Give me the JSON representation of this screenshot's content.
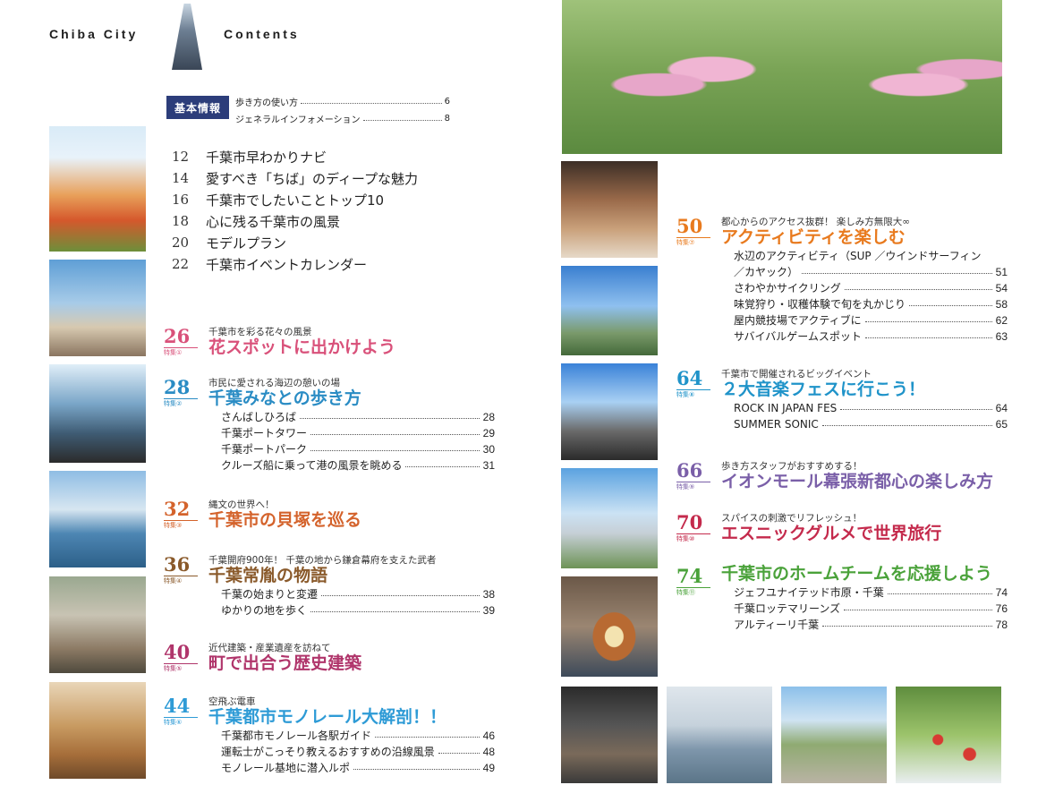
{
  "header": {
    "left": "Chiba City",
    "right": "Contents"
  },
  "basic_info": {
    "tag": "基本情報",
    "rows": [
      {
        "label": "歩き方の使い方",
        "page": "6"
      },
      {
        "label": "ジェネラルインフォメーション",
        "page": "8"
      }
    ]
  },
  "quick_nav": [
    {
      "num": "12",
      "label": "千葉市早わかりナビ"
    },
    {
      "num": "14",
      "label": "愛すべき「ちば」のディープな魅力"
    },
    {
      "num": "16",
      "label": "千葉市でしたいことトップ10"
    },
    {
      "num": "18",
      "label": "心に残る千葉市の風景"
    },
    {
      "num": "20",
      "label": "モデルプラン"
    },
    {
      "num": "22",
      "label": "千葉市イベントカレンダー"
    }
  ],
  "feature_tag": "特集",
  "sections": [
    {
      "num": "26",
      "tok": "特集①",
      "lead": "千葉市を彩る花々の風景",
      "title": "花スポットに出かけよう",
      "color": "#d9517a",
      "items": []
    },
    {
      "num": "28",
      "tok": "特集②",
      "lead": "市民に愛される海辺の憩いの場",
      "title": "千葉みなとの歩き方",
      "color": "#2a8cc4",
      "items": [
        {
          "label": "さんばしひろば",
          "page": "28"
        },
        {
          "label": "千葉ポートタワー",
          "page": "29"
        },
        {
          "label": "千葉ポートパーク",
          "page": "30"
        },
        {
          "label": "クルーズ船に乗って港の風景を眺める",
          "page": "31"
        }
      ]
    },
    {
      "num": "32",
      "tok": "特集③",
      "lead": "縄文の世界へ！",
      "title": "千葉市の貝塚を巡る",
      "color": "#d4632c",
      "items": []
    },
    {
      "num": "36",
      "tok": "特集④",
      "lead": "千葉開府900年！ 千葉の地から鎌倉幕府を支えた武者",
      "title": "千葉常胤の物語",
      "color": "#8a5a2b",
      "items": [
        {
          "label": "千葉の始まりと変遷",
          "page": "38"
        },
        {
          "label": "ゆかりの地を歩く",
          "page": "39"
        }
      ]
    },
    {
      "num": "40",
      "tok": "特集⑤",
      "lead": "近代建築・産業遺産を訪ねて",
      "title": "町で出合う歴史建築",
      "color": "#b0356b",
      "items": []
    },
    {
      "num": "44",
      "tok": "特集⑥",
      "lead": "空飛ぶ電車",
      "title": "千葉都市モノレール大解剖！！",
      "color": "#2e9bd6",
      "items": [
        {
          "label": "千葉都市モノレール各駅ガイド",
          "page": "46"
        },
        {
          "label": "運転士がこっそり教えるおすすめの沿線風景",
          "page": "48"
        },
        {
          "label": "モノレール基地に潜入ルポ",
          "page": "49"
        }
      ]
    },
    {
      "num": "50",
      "tok": "特集⑦",
      "lead": "都心からのアクセス抜群！ 楽しみ方無限大∞",
      "title": "アクティビティを楽しむ",
      "color": "#e87a1e",
      "items": [
        {
          "label": "水辺のアクティビティ（SUP ／ウインドサーフィン",
          "page": ""
        },
        {
          "label": "／カヤック）",
          "page": "51"
        },
        {
          "label": "さわやかサイクリング",
          "page": "54"
        },
        {
          "label": "味覚狩り・収穫体験で旬を丸かじり",
          "page": "58"
        },
        {
          "label": "屋内競技場でアクティブに",
          "page": "62"
        },
        {
          "label": "サバイバルゲームスポット",
          "page": "63"
        }
      ]
    },
    {
      "num": "64",
      "tok": "特集⑧",
      "lead": "千葉市で開催されるビッグイベント",
      "title": "２大音楽フェスに行こう！",
      "color": "#1f93c9",
      "items": [
        {
          "label": "ROCK IN JAPAN FES",
          "page": "64"
        },
        {
          "label": "SUMMER SONIC",
          "page": "65"
        }
      ]
    },
    {
      "num": "66",
      "tok": "特集⑨",
      "lead": "歩き方スタッフがおすすめする！",
      "title": "イオンモール幕張新都心の楽しみ方",
      "color": "#7a5fa8",
      "items": []
    },
    {
      "num": "70",
      "tok": "特集⑩",
      "lead": "スパイスの刺激でリフレッシュ！",
      "title": "エスニックグルメで世界旅行",
      "color": "#c42a4c",
      "items": []
    },
    {
      "num": "74",
      "tok": "特集⑪",
      "lead": "",
      "title": "千葉市のホームチームを応援しよう",
      "color": "#4aa23a",
      "items": [
        {
          "label": "ジェフユナイテッド市原・千葉",
          "page": "74"
        },
        {
          "label": "千葉ロッテマリーンズ",
          "page": "76"
        },
        {
          "label": "アルティーリ千葉",
          "page": "78"
        }
      ]
    }
  ],
  "colors": {
    "navy": "#2c3d7a"
  }
}
